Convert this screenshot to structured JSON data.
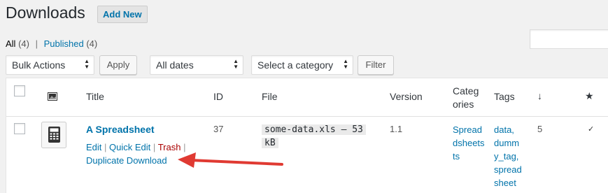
{
  "header": {
    "title": "Downloads",
    "add_new_label": "Add New"
  },
  "views": {
    "all_label": "All",
    "all_count": "(4)",
    "separator": "|",
    "published_label": "Published",
    "published_count": "(4)"
  },
  "filters": {
    "bulk_actions": "Bulk Actions",
    "apply_label": "Apply",
    "dates": "All dates",
    "category": "Select a category",
    "filter_label": "Filter"
  },
  "table": {
    "columns": {
      "title": "Title",
      "id": "ID",
      "file": "File",
      "version": "Version",
      "categories_line1": "Categ",
      "categories_line2": "ories",
      "tags": "Tags",
      "downloads_sort": "↓",
      "featured": "★"
    },
    "rows": [
      {
        "title": "A Spreadsheet",
        "id": "37",
        "file_line1": "some-data.xls – 53",
        "file_line2": "kB",
        "version": "1.1",
        "categories": [
          "Spread",
          "dsheets",
          "ts"
        ],
        "tags": [
          "data,",
          "dumm",
          "y_tag,",
          "spread",
          "sheet"
        ],
        "downloads": "5",
        "featured": "✓",
        "actions": {
          "edit": "Edit",
          "quick_edit": "Quick Edit",
          "trash": "Trash",
          "separator": "|",
          "duplicate": "Duplicate Download"
        }
      }
    ]
  },
  "colors": {
    "link": "#0073aa",
    "trash": "#aa0000",
    "arrow": "#e03a32"
  }
}
